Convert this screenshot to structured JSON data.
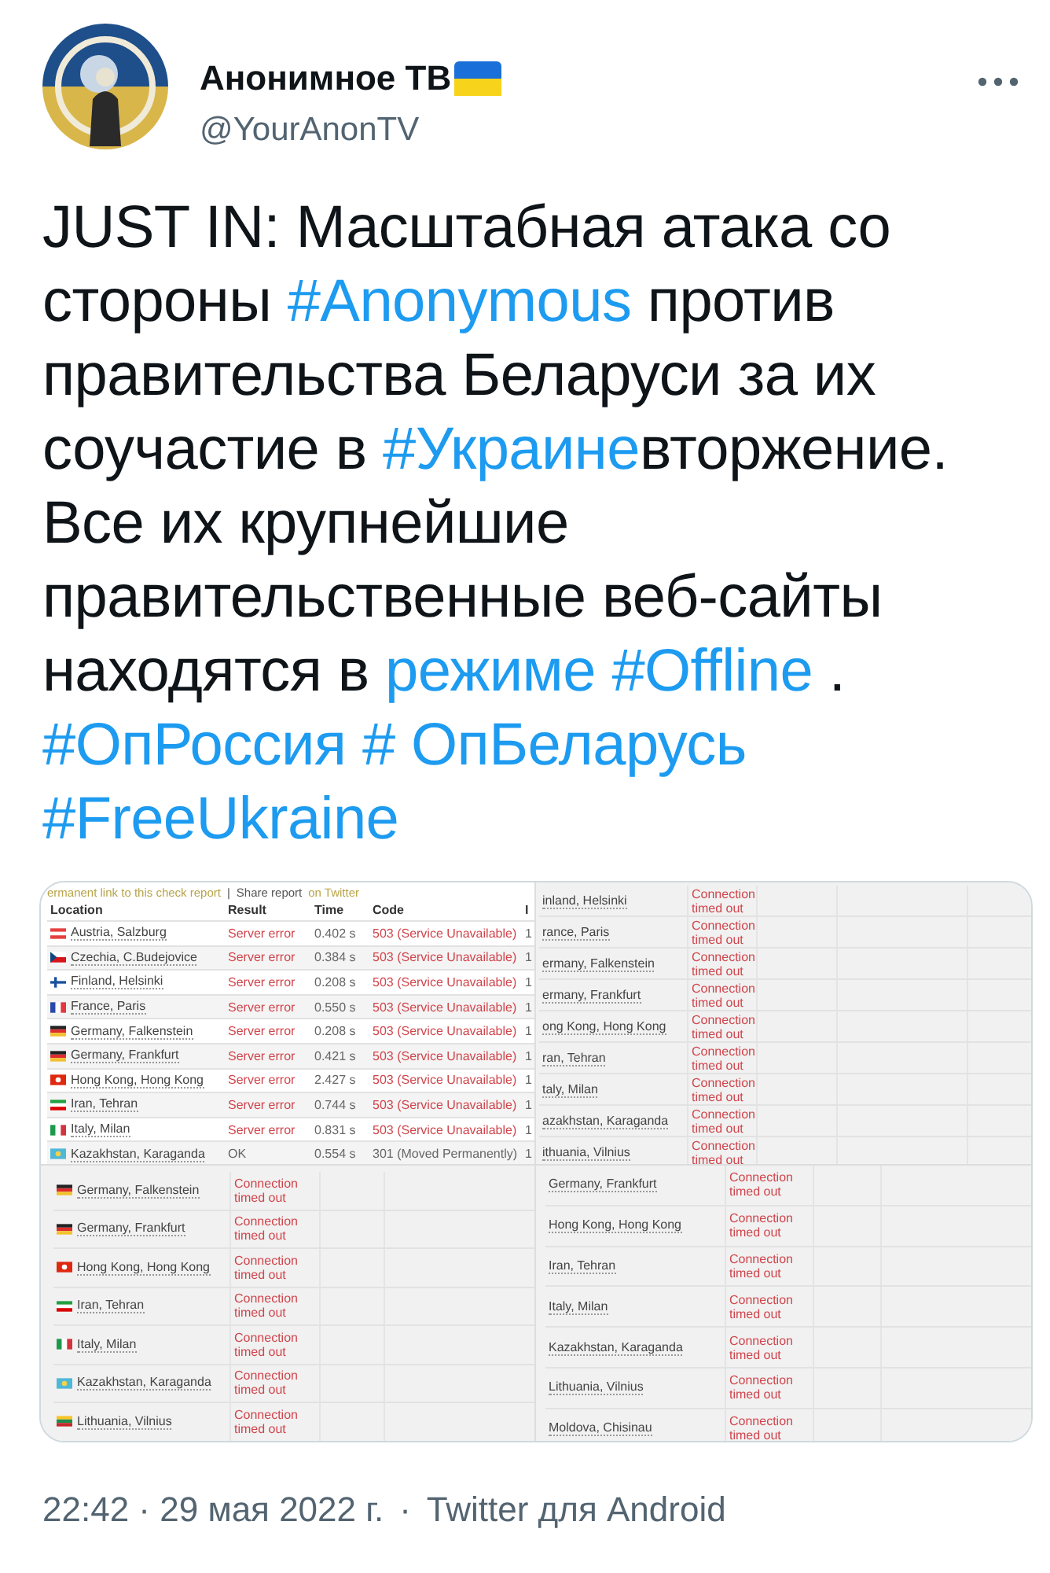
{
  "author": {
    "name": "Анонимное ТВ",
    "handle": "@YourAnonTV"
  },
  "tweet": {
    "segments": [
      {
        "kind": "text",
        "text": "JUST IN: Масштабная атака со стороны "
      },
      {
        "kind": "link",
        "text": "#Anonymous"
      },
      {
        "kind": "text",
        "text": " против правительства Беларуси за их соучастие в "
      },
      {
        "kind": "link",
        "text": "#Украине"
      },
      {
        "kind": "text",
        "text": "вторжение. Все их крупнейшие правительственные веб-сайты находятся в "
      },
      {
        "kind": "link",
        "text": "режиме #Offline"
      },
      {
        "kind": "text",
        "text": " . "
      },
      {
        "kind": "break"
      },
      {
        "kind": "link",
        "text": "#ОпРоссия # ОпБеларусь"
      },
      {
        "kind": "break"
      },
      {
        "kind": "link",
        "text": "#FreeUkraine"
      }
    ]
  },
  "media": {
    "panels": [
      {
        "links": [
          {
            "kind": "link",
            "text": "ermanent link to this check report"
          },
          {
            "kind": "text",
            "text": "|"
          },
          {
            "kind": "plain",
            "text": "Share report"
          },
          {
            "kind": "link",
            "text": "on Twitter"
          }
        ],
        "columns": [
          "Location",
          "Result",
          "Time",
          "Code",
          "I"
        ],
        "rows": [
          {
            "kind": "austria",
            "ok": false,
            "cells": [
              "Austria, Salzburg",
              "Server error",
              "0.402 s",
              "503 (Service Unavailable)",
              "1"
            ]
          },
          {
            "kind": "czechia",
            "ok": false,
            "cells": [
              "Czechia, C.Budejovice",
              "Server error",
              "0.384 s",
              "503 (Service Unavailable)",
              "1"
            ]
          },
          {
            "kind": "finland",
            "ok": false,
            "cells": [
              "Finland, Helsinki",
              "Server error",
              "0.208 s",
              "503 (Service Unavailable)",
              "1"
            ]
          },
          {
            "kind": "france",
            "ok": false,
            "cells": [
              "France, Paris",
              "Server error",
              "0.550 s",
              "503 (Service Unavailable)",
              "1"
            ]
          },
          {
            "kind": "germany",
            "ok": false,
            "cells": [
              "Germany, Falkenstein",
              "Server error",
              "0.208 s",
              "503 (Service Unavailable)",
              "1"
            ]
          },
          {
            "kind": "germany",
            "ok": false,
            "cells": [
              "Germany, Frankfurt",
              "Server error",
              "0.421 s",
              "503 (Service Unavailable)",
              "1"
            ]
          },
          {
            "kind": "hongkong",
            "ok": false,
            "cells": [
              "Hong Kong, Hong Kong",
              "Server error",
              "2.427 s",
              "503 (Service Unavailable)",
              "1"
            ]
          },
          {
            "kind": "iran",
            "ok": false,
            "cells": [
              "Iran, Tehran",
              "Server error",
              "0.744 s",
              "503 (Service Unavailable)",
              "1"
            ]
          },
          {
            "kind": "italy",
            "ok": false,
            "cells": [
              "Italy, Milan",
              "Server error",
              "0.831 s",
              "503 (Service Unavailable)",
              "1"
            ]
          },
          {
            "kind": "kazakhstan",
            "ok": true,
            "cells": [
              "Kazakhstan, Karaganda",
              "OK",
              "0.554 s",
              "301 (Moved Permanently)",
              "1"
            ]
          }
        ]
      },
      {
        "rows": [
          {
            "ok": false,
            "cells": [
              "inland, Helsinki",
              "Connection timed out"
            ]
          },
          {
            "ok": false,
            "cells": [
              "rance, Paris",
              "Connection timed out"
            ]
          },
          {
            "ok": false,
            "cells": [
              "ermany, Falkenstein",
              "Connection timed out"
            ]
          },
          {
            "ok": false,
            "cells": [
              "ermany, Frankfurt",
              "Connection timed out"
            ]
          },
          {
            "ok": false,
            "cells": [
              "ong Kong, Hong Kong",
              "Connection timed out"
            ]
          },
          {
            "ok": false,
            "cells": [
              "ran, Tehran",
              "Connection timed out"
            ]
          },
          {
            "ok": false,
            "cells": [
              "taly, Milan",
              "Connection timed out"
            ]
          },
          {
            "ok": false,
            "cells": [
              "azakhstan, Karaganda",
              "Connection timed out"
            ]
          },
          {
            "ok": false,
            "cells": [
              "ithuania, Vilnius",
              "Connection timed out"
            ]
          }
        ]
      },
      {
        "rows": [
          {
            "kind": "germany",
            "ok": false,
            "cells": [
              "Germany, Falkenstein",
              "Connection timed out"
            ]
          },
          {
            "kind": "germany",
            "ok": false,
            "cells": [
              "Germany, Frankfurt",
              "Connection timed out"
            ]
          },
          {
            "kind": "hongkong",
            "ok": false,
            "cells": [
              "Hong Kong, Hong Kong",
              "Connection timed out"
            ]
          },
          {
            "kind": "iran",
            "ok": false,
            "cells": [
              "Iran, Tehran",
              "Connection timed out"
            ]
          },
          {
            "kind": "italy",
            "ok": false,
            "cells": [
              "Italy, Milan",
              "Connection timed out"
            ]
          },
          {
            "kind": "kazakhstan",
            "ok": false,
            "cells": [
              "Kazakhstan, Karaganda",
              "Connection timed out"
            ]
          },
          {
            "kind": "lithuania",
            "ok": false,
            "cells": [
              "Lithuania, Vilnius",
              "Connection timed out"
            ]
          }
        ]
      },
      {
        "rows": [
          {
            "ok": false,
            "cells": [
              "Germany, Frankfurt",
              "Connection timed out"
            ]
          },
          {
            "ok": false,
            "cells": [
              "Hong Kong, Hong Kong",
              "Connection timed out"
            ]
          },
          {
            "ok": false,
            "cells": [
              "Iran, Tehran",
              "Connection timed out"
            ]
          },
          {
            "ok": false,
            "cells": [
              "Italy, Milan",
              "Connection timed out"
            ]
          },
          {
            "ok": false,
            "cells": [
              "Kazakhstan, Karaganda",
              "Connection timed out"
            ]
          },
          {
            "ok": false,
            "cells": [
              "Lithuania, Vilnius",
              "Connection timed out"
            ]
          },
          {
            "ok": false,
            "cells": [
              "Moldova, Chisinau",
              "Connection timed out"
            ]
          }
        ]
      }
    ]
  },
  "footer": {
    "timestamp": "22:42 · 29 мая 2022 г.",
    "separator": "·",
    "source": "Twitter для Android"
  }
}
